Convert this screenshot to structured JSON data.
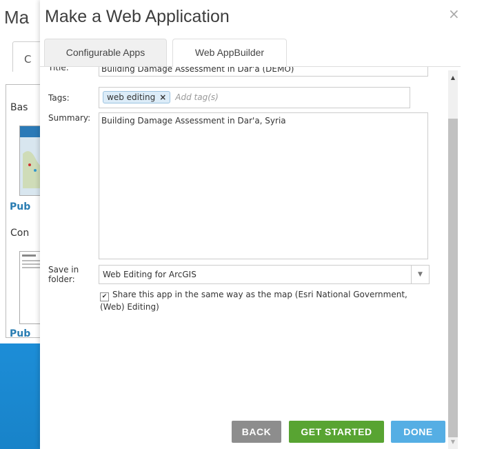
{
  "background_dialog": {
    "title_fragment": "Ma",
    "tab_fragment": "C",
    "label_basic": "Bas",
    "link_1": "Pub",
    "label_con": "Con",
    "link_2": "Pub"
  },
  "dialog": {
    "title": "Make a Web Application",
    "close_glyph": "×",
    "tabs": [
      {
        "label": "Configurable Apps"
      },
      {
        "label": "Web AppBuilder"
      }
    ]
  },
  "form": {
    "title_label": "Title:",
    "title_value": "Building Damage Assessment in Dar'a (DEMO)",
    "tags_label": "Tags:",
    "tags": [
      "web editing"
    ],
    "tag_remove_glyph": "×",
    "tags_placeholder": "Add tag(s)",
    "summary_label": "Summary:",
    "summary_value": "Building Damage Assessment in Dar'a, Syria",
    "folder_label_line1": "Save in",
    "folder_label_line2": "folder:",
    "folder_value": "Web Editing for ArcGIS",
    "share_checked": true,
    "share_text": "Share this app in the same way as the map (Esri National Government, (Web) Editing)"
  },
  "buttons": {
    "back": "BACK",
    "get_started": "GET STARTED",
    "done": "DONE"
  },
  "colors": {
    "back": "#8d8d8d",
    "get_started": "#58a432",
    "done": "#55aee4",
    "background": "#1582cc"
  }
}
